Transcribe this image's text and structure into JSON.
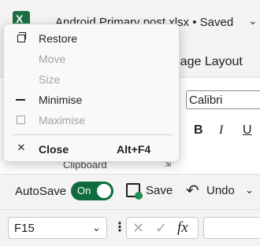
{
  "titlebar": {
    "title": "Android Primary post.xlsx • Saved",
    "chevron": "⌄"
  },
  "ribbon": {
    "tab_page_layout": "Page Layout",
    "font_name": "Calibri",
    "bold": "B",
    "italic": "I",
    "underline": "U",
    "clipboard_label": "Clipboard",
    "dialog_launcher": "⇲"
  },
  "qat": {
    "autosave_label": "AutoSave",
    "toggle_state": "On",
    "save_label": "Save",
    "undo_label": "Undo",
    "more": "⌄"
  },
  "formula_bar": {
    "name_box_value": "F15",
    "name_box_chevron": "⌄",
    "kebab": "⋮",
    "cancel": "✕",
    "enter": "✓",
    "fx": "fx"
  },
  "system_menu": {
    "items": [
      {
        "label": "Restore",
        "enabled": true
      },
      {
        "label": "Move",
        "enabled": false
      },
      {
        "label": "Size",
        "enabled": false
      },
      {
        "label": "Minimise",
        "enabled": true
      },
      {
        "label": "Maximise",
        "enabled": false
      },
      {
        "label": "Close",
        "enabled": true,
        "shortcut": "Alt+F4"
      }
    ],
    "close_icon": "✕"
  },
  "colors": {
    "accent_green": "#0f6c3d",
    "disabled_text": "#a3a3a3"
  }
}
